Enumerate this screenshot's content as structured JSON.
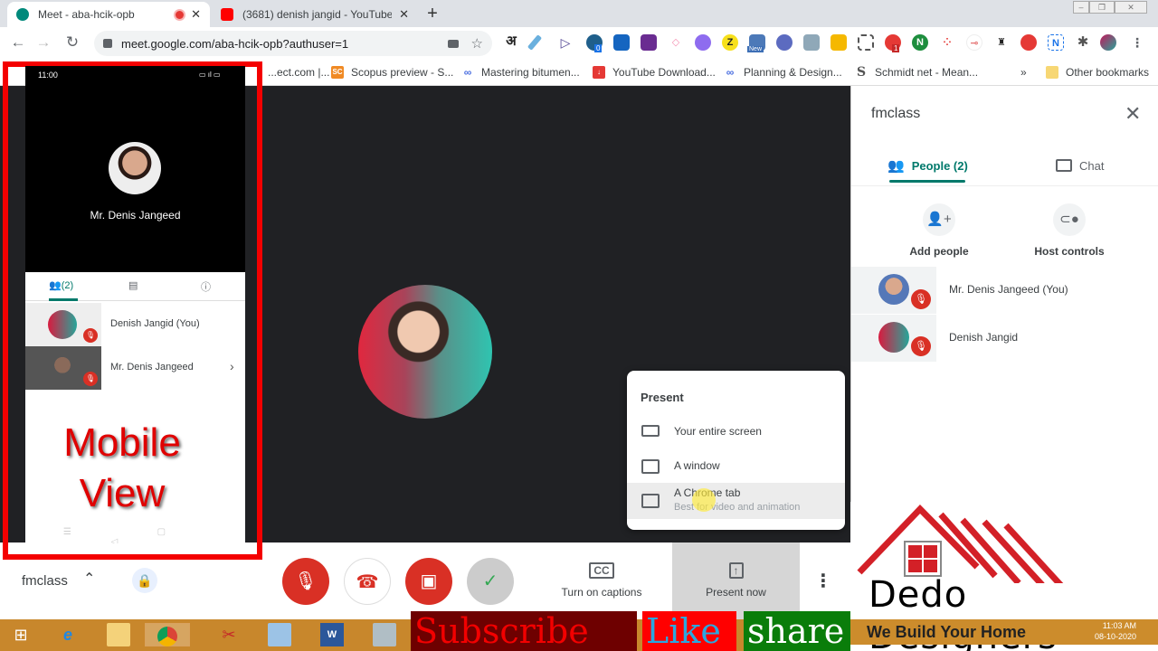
{
  "browser": {
    "tabs": [
      {
        "title": "Meet - aba-hcik-opb",
        "active": true,
        "recording": true
      },
      {
        "title": "(3681) denish jangid - YouTube",
        "active": false
      }
    ],
    "new_tab": "+",
    "url": "meet.google.com/aba-hcik-opb?authuser=1",
    "extension_badges": {
      "badge_0": "0",
      "badge_new": "New",
      "badge_1": "1"
    },
    "hindi_ext": "अ",
    "bookmarks": [
      {
        "label": "...ect.com |...",
        "icon": "sciencedirect"
      },
      {
        "label": "Scopus preview - S...",
        "icon": "SC"
      },
      {
        "label": "Mastering bitumen...",
        "icon": "link"
      },
      {
        "label": "YouTube Download...",
        "icon": "download"
      },
      {
        "label": "Planning & Design...",
        "icon": "link"
      },
      {
        "label": "Schmidt net - Mean...",
        "icon": "S"
      }
    ],
    "bookmarks_overflow": "»",
    "other_bookmarks": "Other bookmarks"
  },
  "mobile": {
    "time": "11:00",
    "speaker_name": "Mr. Denis Jangeed",
    "people_count": "(2)",
    "participants": [
      {
        "name": "Denish Jangid (You)",
        "muted": true
      },
      {
        "name": "Mr. Denis Jangeed",
        "muted": true,
        "chevron": "›"
      }
    ],
    "overlay_text_line1": "Mobile",
    "overlay_text_line2": "View",
    "nav_icons": "☰ ▢ ◁"
  },
  "present_menu": {
    "title": "Present",
    "items": [
      {
        "label": "Your entire screen",
        "sub": ""
      },
      {
        "label": "A window",
        "sub": ""
      },
      {
        "label": "A Chrome tab",
        "sub": "Best for video and animation",
        "hovered": true
      }
    ]
  },
  "side_panel": {
    "meeting_name": "fmclass",
    "tabs": [
      {
        "label": "People (2)",
        "active": true
      },
      {
        "label": "Chat",
        "active": false
      }
    ],
    "actions": [
      {
        "label": "Add people"
      },
      {
        "label": "Host controls"
      }
    ],
    "participants": [
      {
        "name": "Mr. Denis Jangeed (You)",
        "muted": true
      },
      {
        "name": "Denish Jangid",
        "muted": true
      }
    ]
  },
  "bottom_bar": {
    "meeting_name": "fmclass",
    "captions_label": "Turn on captions",
    "captions_icon": "CC",
    "present_label": "Present now"
  },
  "overlays": {
    "subscribe": "Subscribe",
    "like": "Like",
    "share": "share",
    "logo_name": "Dedo  Designers",
    "logo_tagline": "We Build Your Home",
    "clock_time": "11:03 AM",
    "clock_date": "08-10-2020"
  },
  "colors": {
    "meet_green": "#00796b",
    "mute_red": "#d93025",
    "frame_red": "#f40000",
    "stage_bg": "#202124"
  }
}
